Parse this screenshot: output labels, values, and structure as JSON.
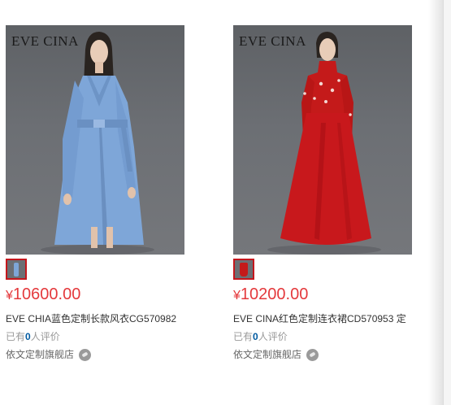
{
  "products": [
    {
      "brand": "EVE CINA",
      "currency": "¥",
      "price": "10600.00",
      "title": "EVE CHIA蓝色定制长款风衣CG570982",
      "review_prefix": "已有",
      "review_count": "0",
      "review_suffix": "人评价",
      "shop": "依文定制旗舰店",
      "dress_color": "#7ea6d8"
    },
    {
      "brand": "EVE CINA",
      "currency": "¥",
      "price": "10200.00",
      "title": "EVE CINA红色定制连衣裙CD570953 定",
      "review_prefix": "已有",
      "review_count": "0",
      "review_suffix": "人评价",
      "shop": "依文定制旗舰店",
      "dress_color": "#c41a1a"
    }
  ]
}
